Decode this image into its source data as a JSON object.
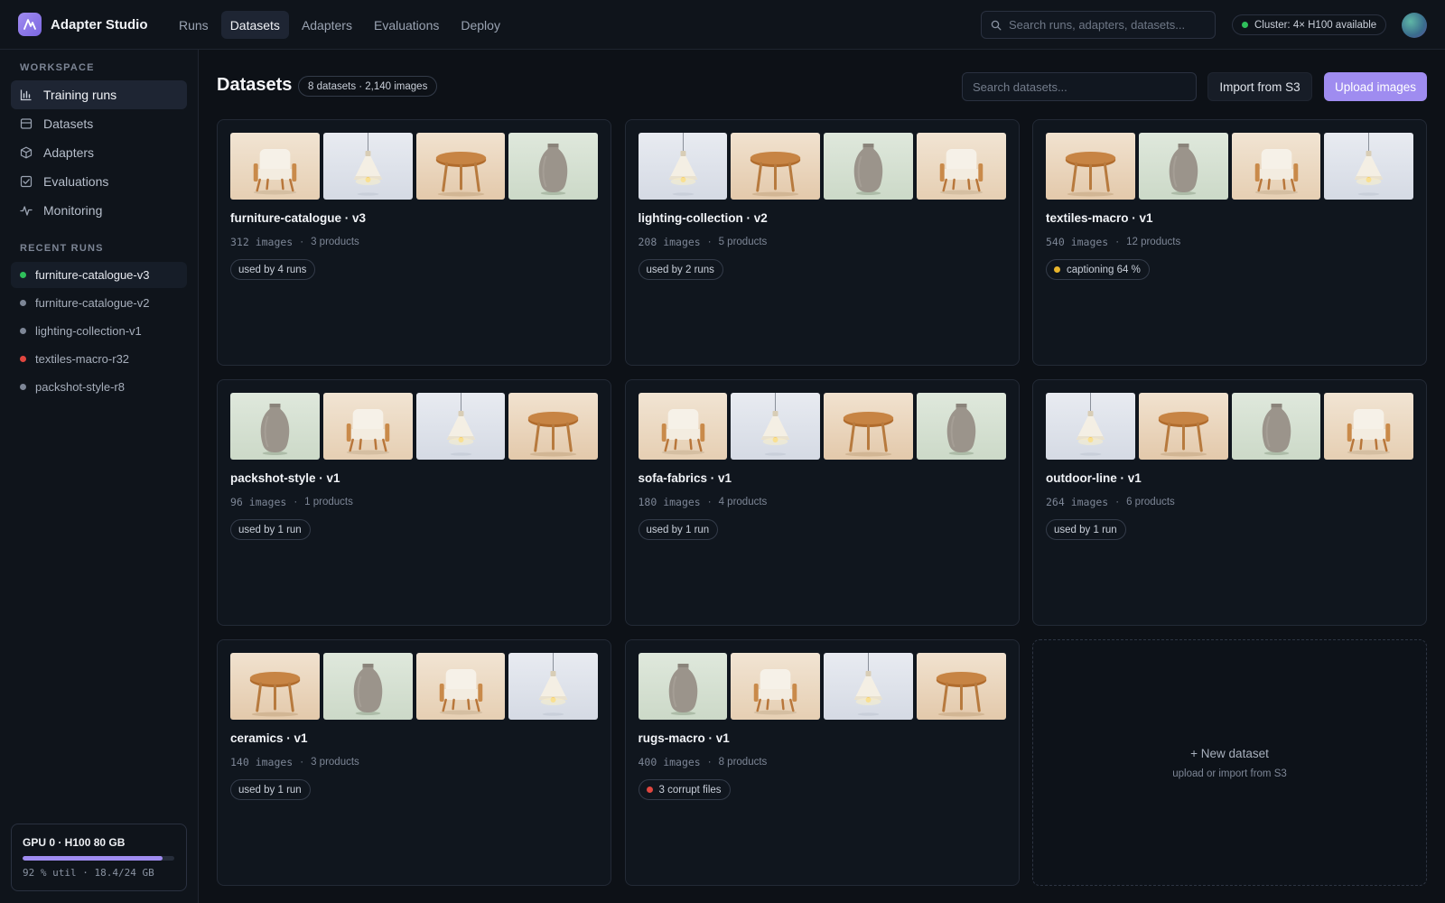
{
  "app": {
    "name": "Adapter Studio"
  },
  "nav": [
    {
      "label": "Runs",
      "active": false
    },
    {
      "label": "Datasets",
      "active": true
    },
    {
      "label": "Adapters",
      "active": false
    },
    {
      "label": "Evaluations",
      "active": false
    },
    {
      "label": "Deploy",
      "active": false
    }
  ],
  "global_search": {
    "placeholder": "Search runs, adapters, datasets..."
  },
  "cluster": {
    "label": "Cluster: 4× H100 available",
    "status_color": "#2fbf5b"
  },
  "sidebar": {
    "workspace_heading": "WORKSPACE",
    "items": [
      {
        "label": "Training runs",
        "icon": "bar-chart-icon",
        "active": true
      },
      {
        "label": "Datasets",
        "icon": "database-icon",
        "active": false
      },
      {
        "label": "Adapters",
        "icon": "cube-icon",
        "active": false
      },
      {
        "label": "Evaluations",
        "icon": "checkbox-icon",
        "active": false
      },
      {
        "label": "Monitoring",
        "icon": "activity-icon",
        "active": false
      }
    ],
    "recent_heading": "RECENT RUNS",
    "recent_runs": [
      {
        "label": "furniture-catalogue-v3",
        "status_color": "#2fbf5b",
        "active": true
      },
      {
        "label": "furniture-catalogue-v2",
        "status_color": "#7d8696",
        "active": false
      },
      {
        "label": "lighting-collection-v1",
        "status_color": "#7d8696",
        "active": false
      },
      {
        "label": "textiles-macro-r32",
        "status_color": "#e0463f",
        "active": false
      },
      {
        "label": "packshot-style-r8",
        "status_color": "#7d8696",
        "active": false
      }
    ],
    "gpu": {
      "title": "GPU 0 · H100 80 GB",
      "utilization": 0.92,
      "subtitle": "92 % util · 18.4/24 GB"
    }
  },
  "page": {
    "title": "Datasets",
    "count_badge": "8 datasets · 2,140 images",
    "search_placeholder": "Search datasets...",
    "import_label": "Import from S3",
    "upload_label": "Upload images",
    "accent_color": "#9f8cf0"
  },
  "datasets": [
    {
      "name": "furniture-catalogue · v3",
      "images": "312 images",
      "products": "3 products",
      "status": "used by 4 runs",
      "status_dot": null,
      "thumbs": [
        "chair",
        "lamp",
        "table",
        "vase"
      ]
    },
    {
      "name": "lighting-collection · v2",
      "images": "208 images",
      "products": "5 products",
      "status": "used by 2 runs",
      "status_dot": null,
      "thumbs": [
        "lamp",
        "table",
        "vase",
        "chair"
      ]
    },
    {
      "name": "textiles-macro · v1",
      "images": "540 images",
      "products": "12 products",
      "status": "captioning 64 %",
      "status_dot": "#e8b52c",
      "thumbs": [
        "table",
        "vase",
        "chair",
        "lamp"
      ]
    },
    {
      "name": "packshot-style · v1",
      "images": "96 images",
      "products": "1 products",
      "status": "used by 1 run",
      "status_dot": null,
      "thumbs": [
        "vase",
        "chair",
        "lamp",
        "table"
      ]
    },
    {
      "name": "sofa-fabrics · v1",
      "images": "180 images",
      "products": "4 products",
      "status": "used by 1 run",
      "status_dot": null,
      "thumbs": [
        "chair",
        "lamp",
        "table",
        "vase"
      ]
    },
    {
      "name": "outdoor-line · v1",
      "images": "264 images",
      "products": "6 products",
      "status": "used by 1 run",
      "status_dot": null,
      "thumbs": [
        "lamp",
        "table",
        "vase",
        "chair"
      ]
    },
    {
      "name": "ceramics · v1",
      "images": "140 images",
      "products": "3 products",
      "status": "used by 1 run",
      "status_dot": null,
      "thumbs": [
        "table",
        "vase",
        "chair",
        "lamp"
      ]
    },
    {
      "name": "rugs-macro · v1",
      "images": "400 images",
      "products": "8 products",
      "status": "3 corrupt files",
      "status_dot": "#e0463f",
      "thumbs": [
        "vase",
        "chair",
        "lamp",
        "table"
      ]
    }
  ],
  "new_dataset": {
    "title": "+ New dataset",
    "subtitle": "upload or import from S3"
  }
}
